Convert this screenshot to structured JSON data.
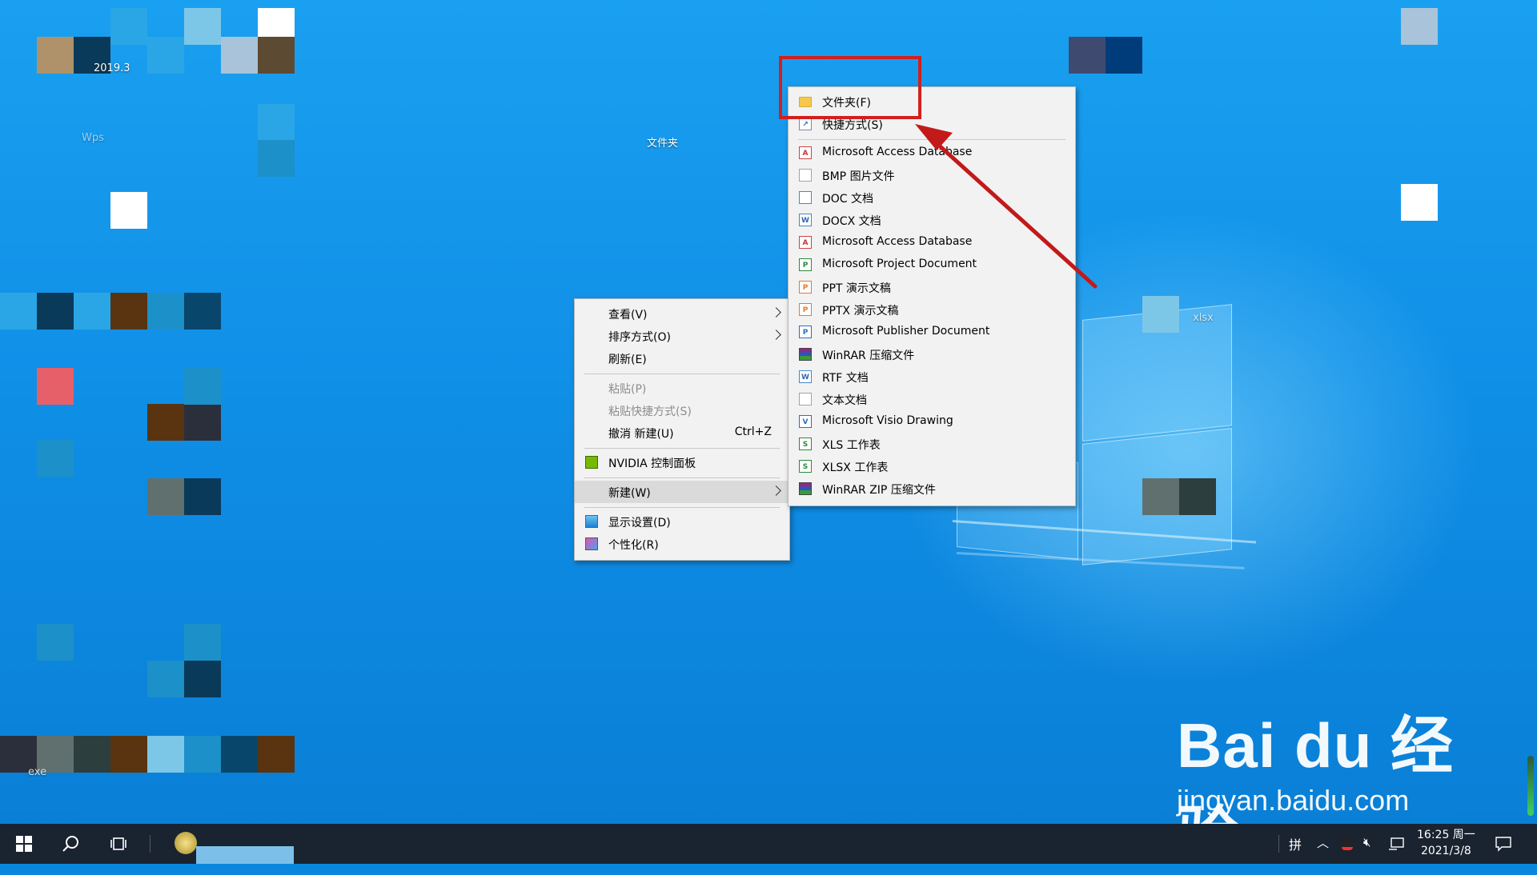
{
  "desktop": {
    "icon_labels": [
      "2019.3",
      "Wps",
      "文件夹",
      "exe",
      "xlsx"
    ],
    "blur_palette": [
      "#b0926a",
      "#0a3a5a",
      "#2aa6e6",
      "#7cc7e8",
      "#a9c3da",
      "#5d4a32",
      "#ffffff",
      "#e6606a",
      "#0e6f99",
      "#2b2f3b",
      "#5a3410",
      "#08466c",
      "#3f4a70",
      "#003b7a",
      "#7dd0f0",
      "#1c90c8",
      "#60706f",
      "#2c3e3e"
    ]
  },
  "context_menu": {
    "items": [
      {
        "label": "查看(V)",
        "submenu": true
      },
      {
        "label": "排序方式(O)",
        "submenu": true
      },
      {
        "label": "刷新(E)"
      },
      {
        "label": "粘贴(P)",
        "disabled": true
      },
      {
        "label": "粘贴快捷方式(S)",
        "disabled": true
      },
      {
        "label": "撤消 新建(U)",
        "shortcut": "Ctrl+Z"
      },
      {
        "label": "NVIDIA 控制面板",
        "icon": "nvidia-icon"
      },
      {
        "label": "新建(W)",
        "submenu": true,
        "highlighted": true
      },
      {
        "label": "显示设置(D)",
        "icon": "display-settings-icon"
      },
      {
        "label": "个性化(R)",
        "icon": "personalize-icon"
      }
    ]
  },
  "new_submenu": {
    "items": [
      {
        "label": "文件夹(F)",
        "icon": "folder-icon"
      },
      {
        "label": "快捷方式(S)",
        "icon": "shortcut-icon"
      },
      {
        "label": "Microsoft Access Database",
        "icon": "access-icon"
      },
      {
        "label": "BMP 图片文件",
        "icon": "bmp-icon"
      },
      {
        "label": "DOC 文档",
        "icon": "doc-icon"
      },
      {
        "label": "DOCX 文档",
        "icon": "docx-icon"
      },
      {
        "label": "Microsoft Access Database",
        "icon": "access-icon"
      },
      {
        "label": "Microsoft Project Document",
        "icon": "project-icon"
      },
      {
        "label": "PPT 演示文稿",
        "icon": "ppt-icon"
      },
      {
        "label": "PPTX 演示文稿",
        "icon": "pptx-icon"
      },
      {
        "label": "Microsoft Publisher Document",
        "icon": "publisher-icon"
      },
      {
        "label": "WinRAR 压缩文件",
        "icon": "winrar-icon"
      },
      {
        "label": "RTF 文档",
        "icon": "rtf-icon"
      },
      {
        "label": "文本文档",
        "icon": "text-document-icon"
      },
      {
        "label": "Microsoft Visio Drawing",
        "icon": "visio-icon"
      },
      {
        "label": "XLS 工作表",
        "icon": "xls-icon"
      },
      {
        "label": "XLSX 工作表",
        "icon": "xlsx-icon"
      },
      {
        "label": "WinRAR ZIP 压缩文件",
        "icon": "winrar-zip-icon"
      }
    ]
  },
  "annotation": {
    "color": "#d21f1f"
  },
  "watermark": {
    "brand": "Bai du 经验",
    "url": "jingyan.baidu.com"
  },
  "taskbar": {
    "ime_label": "拼",
    "time": "16:25 周一",
    "date": "2021/3/8"
  }
}
